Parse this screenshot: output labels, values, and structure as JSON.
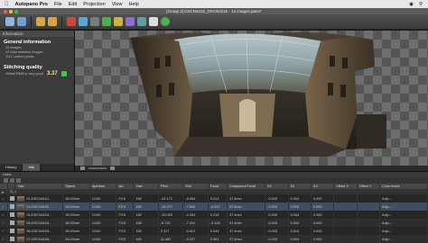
{
  "menubar": {
    "app": "Autopano Pro",
    "items": [
      "File",
      "Edit",
      "Projection",
      "View",
      "Help"
    ]
  },
  "window": {
    "title": "[Group 2] DSCN4102_DSCN4115 - 13 images.pano*"
  },
  "left_panel": {
    "header": "Information",
    "general_title": "General information",
    "general_lines": [
      "13 images",
      "42 links between images",
      "1112 control points"
    ],
    "quality_title": "Stitching quality",
    "quality_label": "Global RMS is very good",
    "quality_value": "3.37",
    "tabs": [
      "History",
      "Info"
    ]
  },
  "table": {
    "title": "Links",
    "columns": [
      "",
      "",
      "Yaw",
      "Speed",
      "Aperture",
      "Iso",
      "Yaw",
      "Pitch",
      "Roll",
      "Focal",
      "Compound Focal",
      "K1",
      "K2",
      "K3",
      "Offset X",
      "Offset Y",
      "Color levels"
    ],
    "group_label": "G_1",
    "rows": [
      {
        "name": "02-DSCN4101...",
        "focal": "35.00mm",
        "speed": "1/100",
        "aperture": "F3.5",
        "iso": "160",
        "yaw": "-23.172",
        "pitch": "-8.063",
        "roll": "0.013",
        "cfocal": "37.4mm",
        "k1": "-0.003",
        "k2": "0.004",
        "k3": "0.000",
        "ox": "",
        "oy": "",
        "color": "Adju...",
        "sel": false
      },
      {
        "name": "03-DSCN4102...",
        "focal": "35.00mm",
        "speed": "1/100",
        "aperture": "F3.5",
        "iso": "160",
        "yaw": "-16.277",
        "pitch": "-7.849",
        "roll": "-0.012",
        "cfocal": "37.4mm",
        "k1": "-0.003",
        "k2": "0.004",
        "k3": "0.000",
        "ox": "",
        "oy": "",
        "color": "Adju...",
        "sel": true
      },
      {
        "name": "04-DSCN4103...",
        "focal": "35.00mm",
        "speed": "1/100",
        "aperture": "F3.5",
        "iso": "160",
        "yaw": "-15.063",
        "pitch": "-4.163",
        "roll": "0.215",
        "cfocal": "37.4mm",
        "k1": "-0.003",
        "k2": "0.004",
        "k3": "0.000",
        "ox": "",
        "oy": "",
        "color": "Adju...",
        "sel": false
      },
      {
        "name": "05-DSCN4104...",
        "focal": "35.00mm",
        "speed": "1/100",
        "aperture": "F3.5",
        "iso": "160",
        "yaw": "-6.721",
        "pitch": "-7.201",
        "roll": "-0.128",
        "cfocal": "37.4mm",
        "k1": "-0.003",
        "k2": "0.004",
        "k3": "0.000",
        "ox": "",
        "oy": "",
        "color": "Adju...",
        "sel": false
      },
      {
        "name": "06-DSCN4105...",
        "focal": "35.00mm",
        "speed": "1/100",
        "aperture": "F3.5",
        "iso": "160",
        "yaw": "2.317",
        "pitch": "-6.912",
        "roll": "0.044",
        "cfocal": "37.4mm",
        "k1": "-0.003",
        "k2": "0.004",
        "k3": "0.000",
        "ox": "",
        "oy": "",
        "color": "Adju...",
        "sel": false
      },
      {
        "name": "07-DSCN4106...",
        "focal": "35.00mm",
        "speed": "1/100",
        "aperture": "F3.5",
        "iso": "160",
        "yaw": "11.482",
        "pitch": "-5.227",
        "roll": "0.301",
        "cfocal": "37.4mm",
        "k1": "-0.003",
        "k2": "0.004",
        "k3": "0.000",
        "ox": "",
        "oy": "",
        "color": "Adju...",
        "sel": false
      }
    ]
  },
  "colors": {
    "accent_green": "#49c24a",
    "selection": "#3d4f63"
  }
}
